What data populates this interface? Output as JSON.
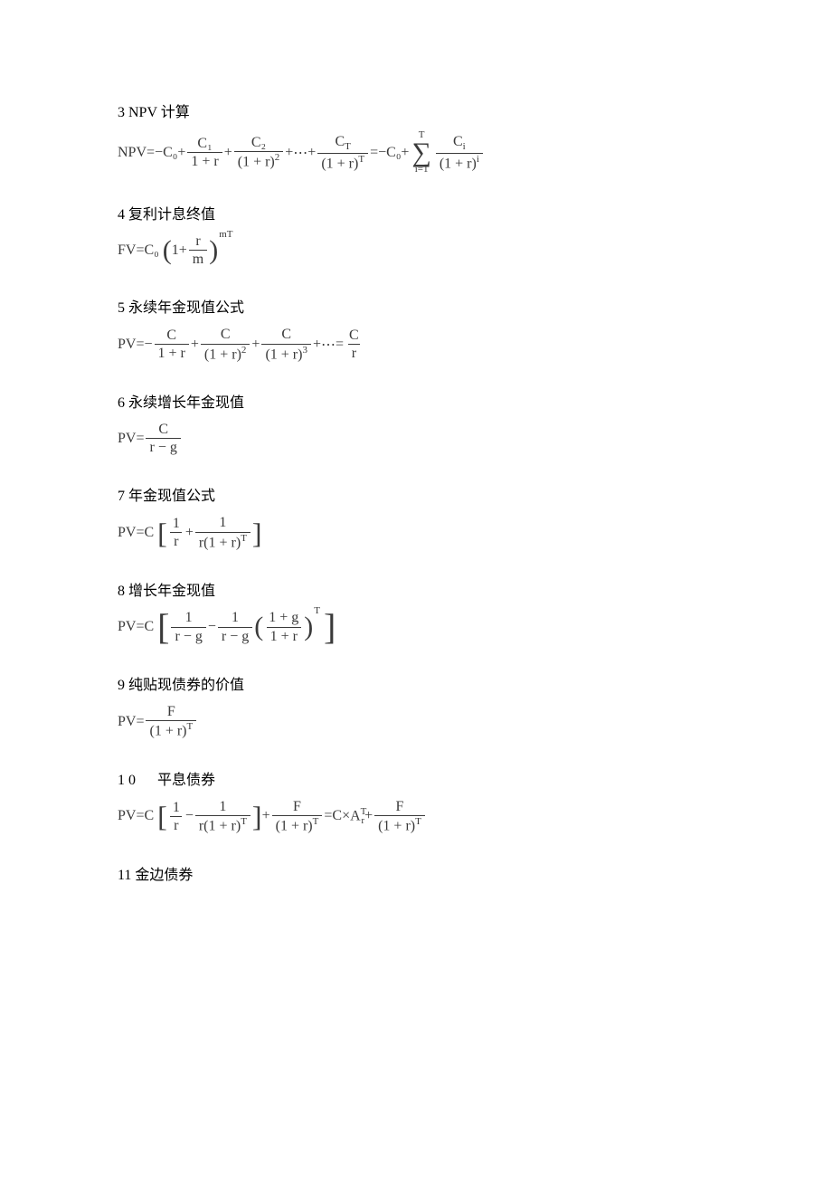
{
  "s3": {
    "heading": "3  NPV 计算"
  },
  "s4": {
    "heading": "4  复利计息终值"
  },
  "s5": {
    "heading": "5  永续年金现值公式"
  },
  "s6": {
    "heading": "6  永续增长年金现值"
  },
  "s7": {
    "heading": "7  年金现值公式"
  },
  "s8": {
    "heading": "8  增长年金现值"
  },
  "s9": {
    "heading": "9 纯贴现债券的价值"
  },
  "s10": {
    "heading": " 1  0 　 平息债券"
  },
  "s11": {
    "heading": "11  金边债券"
  },
  "sym": {
    "NPV": "NPV",
    "FV": "FV",
    "PV": "PV",
    "C": "C",
    "C0": "C₀",
    "C1": "C₁",
    "C2": "C₂",
    "CT": "C",
    "Ci": "C",
    "F": "F",
    "r": "r",
    "g": "g",
    "m": "m",
    "T": "T",
    "i": "i",
    "eq": " = ",
    "plus": " + ",
    "minus": " − ",
    "neg": "−",
    "dots": " ⋯ ",
    "times": " × ",
    "one": "1",
    "ArT": "A",
    "sumTop": "T",
    "sumBot": "i=1",
    "onePr": "1 + r",
    "onePrSq": "(1 + r)",
    "onePg": "1 + g",
    "rmg": "r − g",
    "r1rT": "r(1 + r)",
    "mT": "mT",
    "sq": "2",
    "cb": "3"
  }
}
